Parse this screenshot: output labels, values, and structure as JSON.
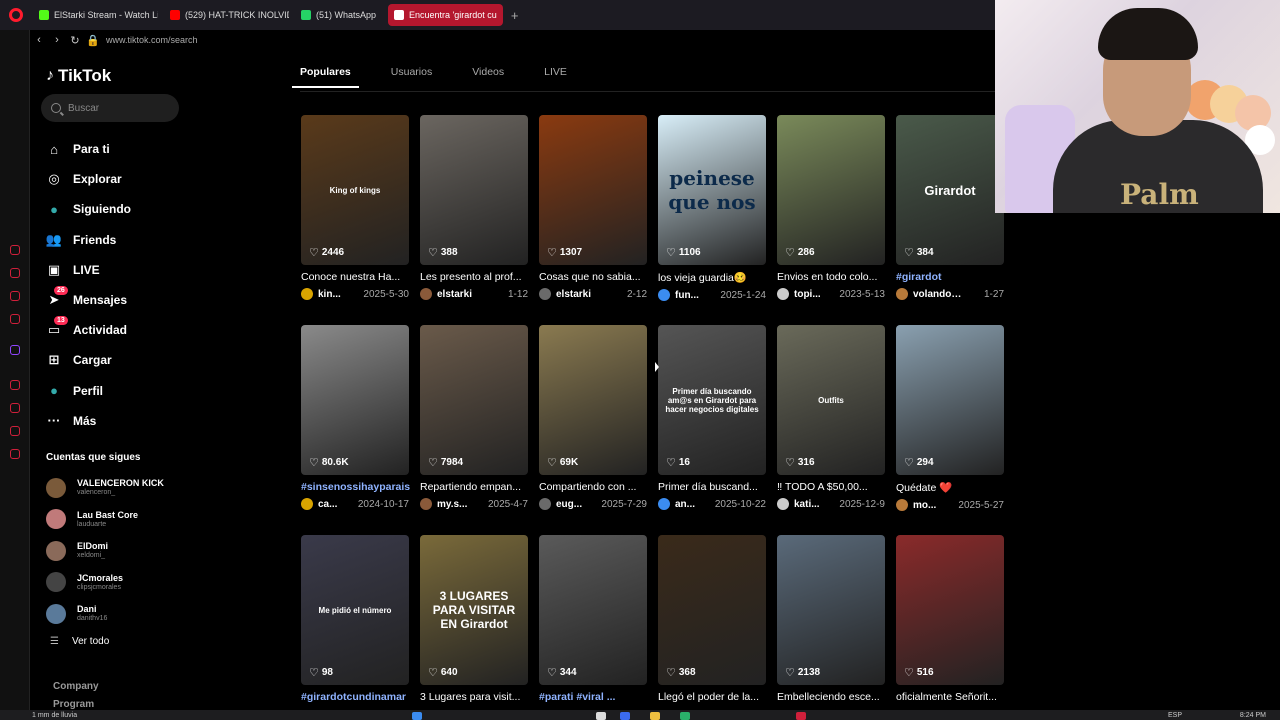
{
  "browser": {
    "tabs": [
      {
        "label": "ElStarki Stream - Watch Live",
        "color": "#53fc18"
      },
      {
        "label": "(529) HAT-TRICK INOLVIDABLE",
        "color": "#ff0000"
      },
      {
        "label": "(51) WhatsApp",
        "color": "#25d366"
      },
      {
        "label": "Encuentra 'girardot cu",
        "color": "#ffffff"
      }
    ],
    "new_tab": "+",
    "url": "www.tiktok.com/search",
    "accent": "#b4172e"
  },
  "sidebar": {
    "logo": "TikTok",
    "search_placeholder": "Buscar",
    "menu": [
      {
        "label": "Para ti",
        "icon": "home-icon"
      },
      {
        "label": "Explorar",
        "icon": "compass-icon"
      },
      {
        "label": "Siguiendo",
        "icon": "avatar-icon"
      },
      {
        "label": "Friends",
        "icon": "friends-icon"
      },
      {
        "label": "LIVE",
        "icon": "live-icon"
      },
      {
        "label": "Mensajes",
        "icon": "send-icon",
        "badge": "26"
      },
      {
        "label": "Actividad",
        "icon": "inbox-icon",
        "badge": "13"
      },
      {
        "label": "Cargar",
        "icon": "plus-icon"
      },
      {
        "label": "Perfil",
        "icon": "profile-avatar-icon"
      },
      {
        "label": "Más",
        "icon": "more-icon"
      }
    ],
    "following_title": "Cuentas que sigues",
    "following": [
      {
        "name": "VALENCERON KICK",
        "handle": "valenceron_",
        "color": "#7a5a3a"
      },
      {
        "name": "Lau Bast Core",
        "handle": "lauduarte",
        "color": "#c07a7a"
      },
      {
        "name": "ElDomi",
        "handle": "xeldomi_",
        "color": "#8a6a5a"
      },
      {
        "name": "JCmorales",
        "handle": "clipsjcmorales",
        "color": "#444444"
      },
      {
        "name": "Dani",
        "handle": "danithv16",
        "color": "#5a7a9a"
      }
    ],
    "see_all": "Ver todo",
    "footer": [
      "Company",
      "Program"
    ]
  },
  "search_tabs": [
    {
      "label": "Populares",
      "active": true
    },
    {
      "label": "Usuarios",
      "active": false
    },
    {
      "label": "Videos",
      "active": false
    },
    {
      "label": "LIVE",
      "active": false
    }
  ],
  "results": [
    {
      "likes": "2446",
      "caption": "Conoce nuestra Ha...",
      "author": "kin...",
      "date": "2025-5-30",
      "bg": "#5a3a1a",
      "overlay": "King of kings",
      "tag": false
    },
    {
      "likes": "388",
      "caption": "Les presento al prof...",
      "author": "elstarki",
      "date": "1-12",
      "bg": "#6b6660",
      "overlay": "",
      "tag": false
    },
    {
      "likes": "1307",
      "caption": "Cosas que no sabia...",
      "author": "elstarki",
      "date": "2-12",
      "bg": "#8a3a10",
      "overlay": "",
      "tag": false
    },
    {
      "likes": "1106",
      "caption": "los vieja guardia🥴",
      "author": "fun...",
      "date": "2025-1-24",
      "bg": "#d8eef8",
      "overlay": "peinese que nos",
      "tag": false
    },
    {
      "likes": "286",
      "caption": "Envios en todo colo...",
      "author": "topi...",
      "date": "2023-5-13",
      "bg": "#7a8a5a",
      "overlay": "",
      "tag": false
    },
    {
      "likes": "384",
      "caption": "#girardot",
      "author": "volandoalt...",
      "date": "1-27",
      "bg": "#4a5a4a",
      "overlay": "Girardot",
      "tag": true
    },
    {
      "likes": "80.6K",
      "caption": "#sinsenossihayparais",
      "author": "ca...",
      "date": "2024-10-17",
      "bg": "#8a8a8a",
      "overlay": "",
      "tag": true
    },
    {
      "likes": "7984",
      "caption": "Repartiendo empan...",
      "author": "my.s...",
      "date": "2025-4-7",
      "bg": "#6a5a4a",
      "overlay": "",
      "tag": false
    },
    {
      "likes": "69K",
      "caption": "Compartiendo con ...",
      "author": "eug...",
      "date": "2025-7-29",
      "bg": "#8a7a50",
      "overlay": "",
      "tag": false
    },
    {
      "likes": "16",
      "caption": "Primer día buscand...",
      "author": "an...",
      "date": "2025-10-22",
      "bg": "#555555",
      "overlay": "Primer día buscando am@s en Girardot para hacer negocios digitales",
      "tag": false
    },
    {
      "likes": "316",
      "caption": "‼ TODO A $50,00...",
      "author": "kati...",
      "date": "2025-12-9",
      "bg": "#6a6a5a",
      "overlay": "Outfits",
      "tag": false
    },
    {
      "likes": "294",
      "caption": "Quédate ❤️",
      "author": "mo...",
      "date": "2025-5-27",
      "bg": "#8aa0b0",
      "overlay": "",
      "tag": false
    },
    {
      "likes": "98",
      "caption": "#girardotcundinamar",
      "author": "",
      "date": "",
      "bg": "#3a3a4a",
      "overlay": "Me pidió el número",
      "tag": true
    },
    {
      "likes": "640",
      "caption": "3 Lugares para visit...",
      "author": "",
      "date": "",
      "bg": "#7a6a3a",
      "overlay": "3 LUGARES PARA VISITAR EN Girardot",
      "tag": false
    },
    {
      "likes": "344",
      "caption": "#parati #viral ...",
      "author": "",
      "date": "",
      "bg": "#5a5a5a",
      "overlay": "",
      "tag": true
    },
    {
      "likes": "368",
      "caption": "Llegó el poder de la...",
      "author": "",
      "date": "",
      "bg": "#3a2a1a",
      "overlay": "",
      "tag": false
    },
    {
      "likes": "2138",
      "caption": "Embelleciendo esce...",
      "author": "",
      "date": "",
      "bg": "#5a6a7a",
      "overlay": "",
      "tag": false
    },
    {
      "likes": "516",
      "caption": "oficialmente Señorit...",
      "author": "",
      "date": "",
      "bg": "#8a2a2a",
      "overlay": "",
      "tag": false
    }
  ],
  "webcam": {
    "print": "Palm"
  },
  "taskbar": {
    "weather": "1 mm de lluvia",
    "lang": "ESP",
    "clock": "8:24 PM"
  }
}
